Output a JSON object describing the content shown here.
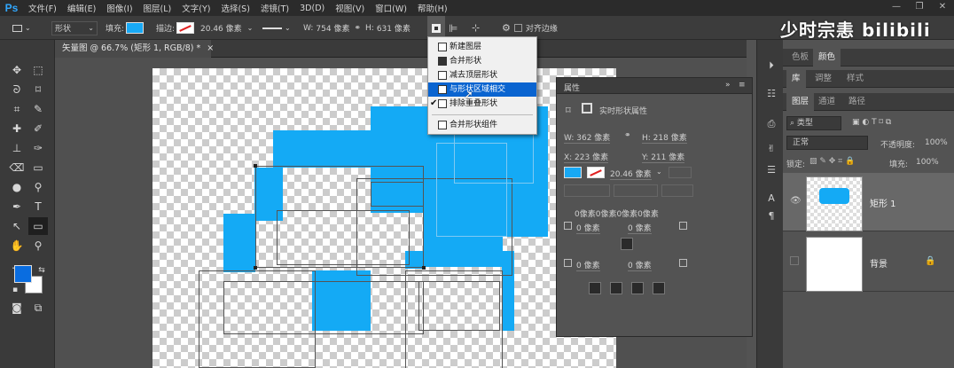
{
  "app": {
    "logo": "Ps"
  },
  "menu": [
    "文件(F)",
    "编辑(E)",
    "图像(I)",
    "图层(L)",
    "文字(Y)",
    "选择(S)",
    "滤镜(T)",
    "3D(D)",
    "视图(V)",
    "窗口(W)",
    "帮助(H)"
  ],
  "options": {
    "mode": "形状",
    "fill_label": "填充:",
    "stroke_label": "描边:",
    "stroke_width": "20.46 像素",
    "w_label": "W:",
    "w_value": "754 像素",
    "link_icon": "link-icon",
    "h_label": "H:",
    "h_value": "631 像素",
    "align_edges": "对齐边缘",
    "fill_color": "#18a9f5"
  },
  "document": {
    "tab_title": "矢量图 @ 66.7% (矩形 1, RGB/8) *",
    "close": "×"
  },
  "path_ops_menu": {
    "items": [
      {
        "label": "新建图层",
        "checked": false,
        "highlighted": false
      },
      {
        "label": "合并形状",
        "checked": false,
        "highlighted": false
      },
      {
        "label": "减去顶层形状",
        "checked": false,
        "highlighted": false
      },
      {
        "label": "与形状区域相交",
        "checked": false,
        "highlighted": true
      },
      {
        "label": "排除重叠形状",
        "checked": true,
        "highlighted": false
      },
      {
        "label": "合并形状组件",
        "checked": false,
        "highlighted": false
      }
    ]
  },
  "properties": {
    "title": "属性",
    "subtitle": "实时形状属性",
    "w": "W: 362 像素",
    "h": "H: 218 像素",
    "x": "X: 223 像素",
    "y": "Y: 211 像素",
    "stroke_width": "20.46 像素",
    "corner_all": "0像素0像素0像素0像素",
    "corner_tl": "0 像素",
    "corner_tr": "0 像素",
    "corner_bl": "0 像素",
    "corner_br": "0 像素"
  },
  "right_panel": {
    "tabs_top": [
      "色板",
      "颜色"
    ],
    "tabs_mid": [
      "库",
      "调整",
      "样式"
    ],
    "tabs_layers": [
      "图层",
      "通道",
      "路径"
    ],
    "filter_kind": "类型",
    "blend_mode": "正常",
    "opacity_label": "不透明度:",
    "opacity_value": "100%",
    "lock_label": "锁定:",
    "fill_label": "填充:",
    "fill_value": "100%",
    "layers": [
      {
        "name": "矩形 1",
        "visible": true
      },
      {
        "name": "背景",
        "visible": false
      }
    ]
  },
  "watermark": "少时宗恚 bilibili"
}
